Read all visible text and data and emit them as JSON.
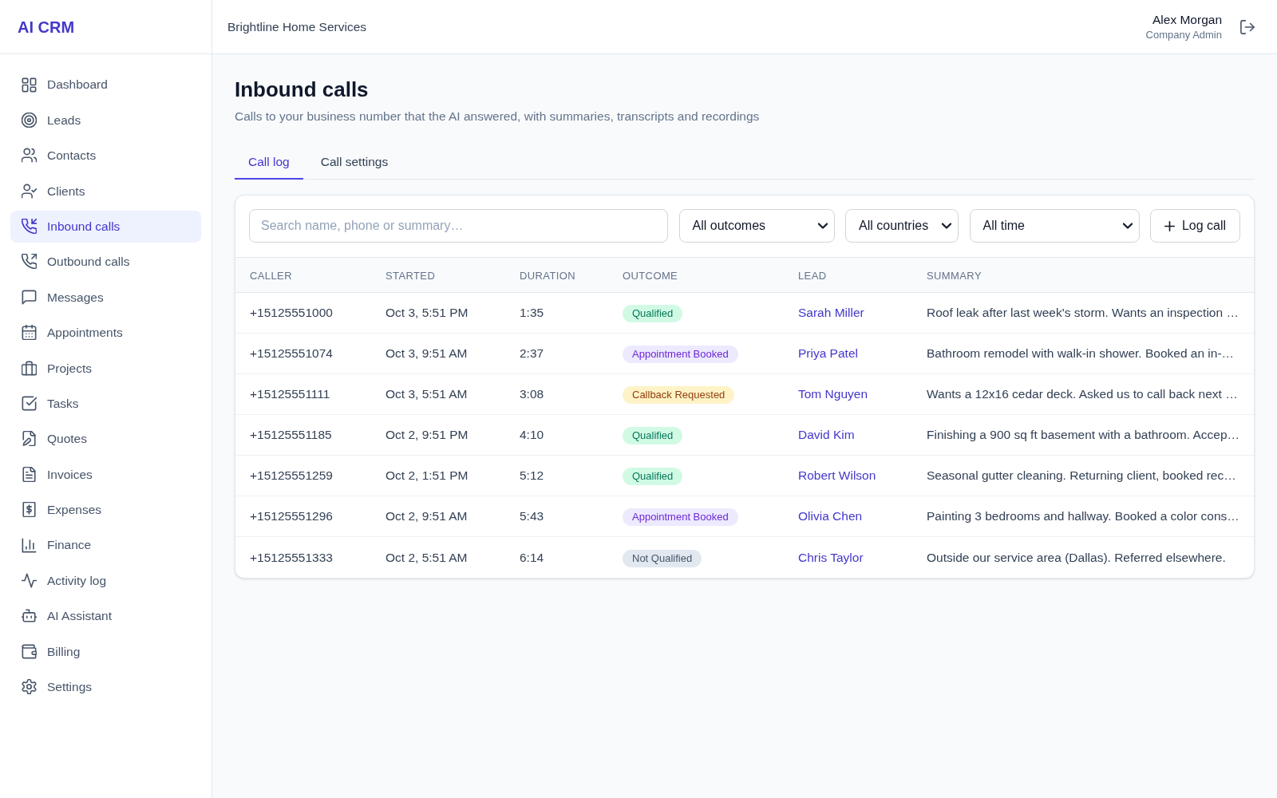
{
  "app": {
    "logo": "AI CRM"
  },
  "sidebar": {
    "items": [
      {
        "label": "Dashboard",
        "selected": false
      },
      {
        "label": "Leads",
        "selected": false
      },
      {
        "label": "Contacts",
        "selected": false
      },
      {
        "label": "Clients",
        "selected": false
      },
      {
        "label": "Inbound calls",
        "selected": true
      },
      {
        "label": "Outbound calls",
        "selected": false
      },
      {
        "label": "Messages",
        "selected": false
      },
      {
        "label": "Appointments",
        "selected": false
      },
      {
        "label": "Projects",
        "selected": false
      },
      {
        "label": "Tasks",
        "selected": false
      },
      {
        "label": "Quotes",
        "selected": false
      },
      {
        "label": "Invoices",
        "selected": false
      },
      {
        "label": "Expenses",
        "selected": false
      },
      {
        "label": "Finance",
        "selected": false
      },
      {
        "label": "Activity log",
        "selected": false
      },
      {
        "label": "AI Assistant",
        "selected": false
      },
      {
        "label": "Billing",
        "selected": false
      },
      {
        "label": "Settings",
        "selected": false
      }
    ]
  },
  "header": {
    "company": "Brightline Home Services",
    "user": {
      "name": "Alex Morgan",
      "role": "Company Admin"
    }
  },
  "page": {
    "title": "Inbound calls",
    "subtitle": "Calls to your business number that the AI answered, with summaries, transcripts and recordings"
  },
  "tabs": [
    {
      "label": "Call log",
      "selected": true
    },
    {
      "label": "Call settings",
      "selected": false
    }
  ],
  "filters": {
    "search": {
      "placeholder": "Search name, phone or summary…"
    },
    "dropdowns": [
      {
        "value": "All outcomes"
      },
      {
        "value": "All countries"
      },
      {
        "value": "All time"
      }
    ],
    "action": {
      "label": "Log call"
    }
  },
  "table": {
    "columns": [
      "CALLER",
      "STARTED",
      "DURATION",
      "OUTCOME",
      "LEAD",
      "SUMMARY"
    ],
    "rows": [
      {
        "caller": "+15125551000",
        "started": "Oct 3, 5:51 PM",
        "duration": "1:35",
        "outcome": {
          "label": "Qualified",
          "kind": "qualified"
        },
        "lead": "Sarah Miller",
        "summary": "Roof leak after last week's storm. Wants an inspection …"
      },
      {
        "caller": "+15125551074",
        "started": "Oct 3, 9:51 AM",
        "duration": "2:37",
        "outcome": {
          "label": "Appointment Booked",
          "kind": "booked"
        },
        "lead": "Priya Patel",
        "summary": "Bathroom remodel with walk-in shower. Booked an in-…"
      },
      {
        "caller": "+15125551111",
        "started": "Oct 3, 5:51 AM",
        "duration": "3:08",
        "outcome": {
          "label": "Callback Requested",
          "kind": "callback"
        },
        "lead": "Tom Nguyen",
        "summary": "Wants a 12x16 cedar deck. Asked us to call back next …"
      },
      {
        "caller": "+15125551185",
        "started": "Oct 2, 9:51 PM",
        "duration": "4:10",
        "outcome": {
          "label": "Qualified",
          "kind": "qualified"
        },
        "lead": "David Kim",
        "summary": "Finishing a 900 sq ft basement with a bathroom. Accep…"
      },
      {
        "caller": "+15125551259",
        "started": "Oct 2, 1:51 PM",
        "duration": "5:12",
        "outcome": {
          "label": "Qualified",
          "kind": "qualified"
        },
        "lead": "Robert Wilson",
        "summary": "Seasonal gutter cleaning. Returning client, booked rec…"
      },
      {
        "caller": "+15125551296",
        "started": "Oct 2, 9:51 AM",
        "duration": "5:43",
        "outcome": {
          "label": "Appointment Booked",
          "kind": "booked"
        },
        "lead": "Olivia Chen",
        "summary": "Painting 3 bedrooms and hallway. Booked a color cons…"
      },
      {
        "caller": "+15125551333",
        "started": "Oct 2, 5:51 AM",
        "duration": "6:14",
        "outcome": {
          "label": "Not Qualified",
          "kind": "unqualified"
        },
        "lead": "Chris Taylor",
        "summary": "Outside our service area (Dallas). Referred elsewhere."
      }
    ]
  }
}
